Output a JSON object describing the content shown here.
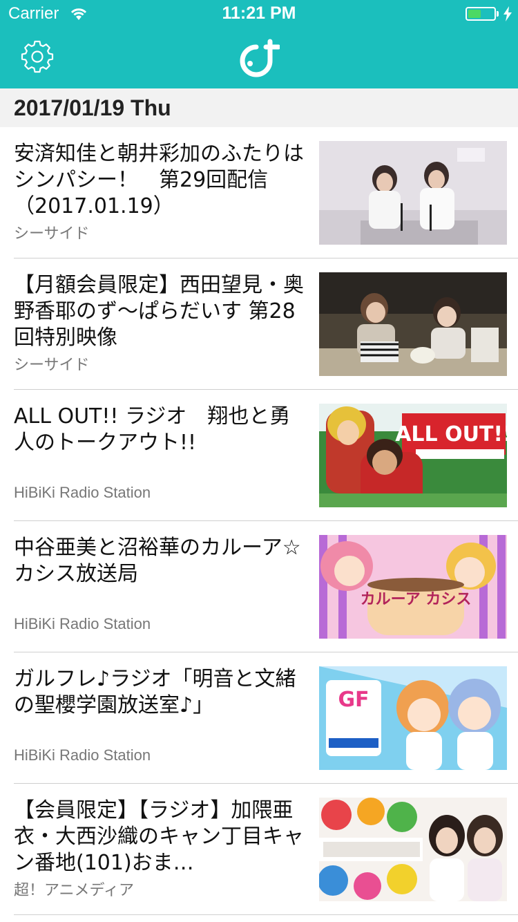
{
  "status_bar": {
    "carrier": "Carrier",
    "time": "11:21 PM",
    "battery_level": 0.5,
    "battery_color": "#4cd964"
  },
  "nav": {
    "left_icon": "gear-icon",
    "center_icon": "app-logo-icon",
    "background": "#1bbfbd"
  },
  "date_header": "2017/01/19 Thu",
  "items": [
    {
      "title": "安済知佳と朝井彩加のふたりはシンパシー！　第29回配信（2017.01.19）",
      "source": "シーサイド",
      "thumbnail": "studio-two-hosts"
    },
    {
      "title": "【月額会員限定】西田望見・奥野香耶のず〜ぱらだいす 第28回特別映像",
      "source": "シーサイド",
      "thumbnail": "studio-two-hosts-table"
    },
    {
      "title": "ALL OUT!! ラジオ　翔也と勇人のトークアウト!!",
      "source": "HiBiKi Radio Station",
      "thumbnail": "all-out-banner",
      "thumb_text": "ALL OUT!!"
    },
    {
      "title": "中谷亜美と沼裕華のカルーア☆カシス放送局",
      "source": "HiBiKi Radio Station",
      "thumbnail": "kahlua-cassis-banner",
      "thumb_text": "カルーア カシス"
    },
    {
      "title": "ガルフレ♪ラジオ「明音と文緒の聖櫻学園放送室♪」",
      "source": "HiBiKi Radio Station",
      "thumbnail": "girlfriend-radio-banner",
      "thumb_text": "GF"
    },
    {
      "title": "【会員限定】【ラジオ】加隈亜衣・大西沙織のキャン丁目キャン番地(101)おま…",
      "source": "超！アニメディア",
      "thumbnail": "can-chome-banner"
    }
  ]
}
